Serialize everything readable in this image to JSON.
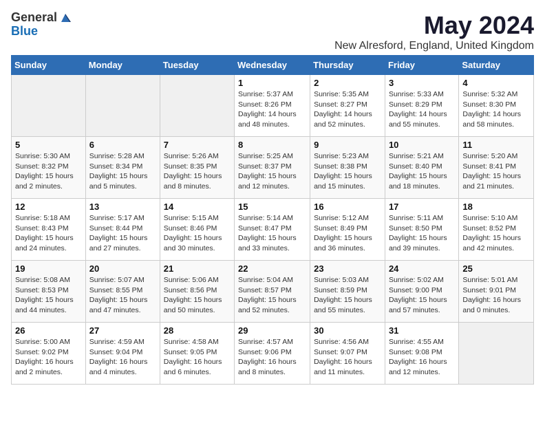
{
  "header": {
    "logo_line1": "General",
    "logo_line2": "Blue",
    "month_title": "May 2024",
    "location": "New Alresford, England, United Kingdom"
  },
  "weekdays": [
    "Sunday",
    "Monday",
    "Tuesday",
    "Wednesday",
    "Thursday",
    "Friday",
    "Saturday"
  ],
  "weeks": [
    [
      {
        "day": "",
        "info": ""
      },
      {
        "day": "",
        "info": ""
      },
      {
        "day": "",
        "info": ""
      },
      {
        "day": "1",
        "info": "Sunrise: 5:37 AM\nSunset: 8:26 PM\nDaylight: 14 hours\nand 48 minutes."
      },
      {
        "day": "2",
        "info": "Sunrise: 5:35 AM\nSunset: 8:27 PM\nDaylight: 14 hours\nand 52 minutes."
      },
      {
        "day": "3",
        "info": "Sunrise: 5:33 AM\nSunset: 8:29 PM\nDaylight: 14 hours\nand 55 minutes."
      },
      {
        "day": "4",
        "info": "Sunrise: 5:32 AM\nSunset: 8:30 PM\nDaylight: 14 hours\nand 58 minutes."
      }
    ],
    [
      {
        "day": "5",
        "info": "Sunrise: 5:30 AM\nSunset: 8:32 PM\nDaylight: 15 hours\nand 2 minutes."
      },
      {
        "day": "6",
        "info": "Sunrise: 5:28 AM\nSunset: 8:34 PM\nDaylight: 15 hours\nand 5 minutes."
      },
      {
        "day": "7",
        "info": "Sunrise: 5:26 AM\nSunset: 8:35 PM\nDaylight: 15 hours\nand 8 minutes."
      },
      {
        "day": "8",
        "info": "Sunrise: 5:25 AM\nSunset: 8:37 PM\nDaylight: 15 hours\nand 12 minutes."
      },
      {
        "day": "9",
        "info": "Sunrise: 5:23 AM\nSunset: 8:38 PM\nDaylight: 15 hours\nand 15 minutes."
      },
      {
        "day": "10",
        "info": "Sunrise: 5:21 AM\nSunset: 8:40 PM\nDaylight: 15 hours\nand 18 minutes."
      },
      {
        "day": "11",
        "info": "Sunrise: 5:20 AM\nSunset: 8:41 PM\nDaylight: 15 hours\nand 21 minutes."
      }
    ],
    [
      {
        "day": "12",
        "info": "Sunrise: 5:18 AM\nSunset: 8:43 PM\nDaylight: 15 hours\nand 24 minutes."
      },
      {
        "day": "13",
        "info": "Sunrise: 5:17 AM\nSunset: 8:44 PM\nDaylight: 15 hours\nand 27 minutes."
      },
      {
        "day": "14",
        "info": "Sunrise: 5:15 AM\nSunset: 8:46 PM\nDaylight: 15 hours\nand 30 minutes."
      },
      {
        "day": "15",
        "info": "Sunrise: 5:14 AM\nSunset: 8:47 PM\nDaylight: 15 hours\nand 33 minutes."
      },
      {
        "day": "16",
        "info": "Sunrise: 5:12 AM\nSunset: 8:49 PM\nDaylight: 15 hours\nand 36 minutes."
      },
      {
        "day": "17",
        "info": "Sunrise: 5:11 AM\nSunset: 8:50 PM\nDaylight: 15 hours\nand 39 minutes."
      },
      {
        "day": "18",
        "info": "Sunrise: 5:10 AM\nSunset: 8:52 PM\nDaylight: 15 hours\nand 42 minutes."
      }
    ],
    [
      {
        "day": "19",
        "info": "Sunrise: 5:08 AM\nSunset: 8:53 PM\nDaylight: 15 hours\nand 44 minutes."
      },
      {
        "day": "20",
        "info": "Sunrise: 5:07 AM\nSunset: 8:55 PM\nDaylight: 15 hours\nand 47 minutes."
      },
      {
        "day": "21",
        "info": "Sunrise: 5:06 AM\nSunset: 8:56 PM\nDaylight: 15 hours\nand 50 minutes."
      },
      {
        "day": "22",
        "info": "Sunrise: 5:04 AM\nSunset: 8:57 PM\nDaylight: 15 hours\nand 52 minutes."
      },
      {
        "day": "23",
        "info": "Sunrise: 5:03 AM\nSunset: 8:59 PM\nDaylight: 15 hours\nand 55 minutes."
      },
      {
        "day": "24",
        "info": "Sunrise: 5:02 AM\nSunset: 9:00 PM\nDaylight: 15 hours\nand 57 minutes."
      },
      {
        "day": "25",
        "info": "Sunrise: 5:01 AM\nSunset: 9:01 PM\nDaylight: 16 hours\nand 0 minutes."
      }
    ],
    [
      {
        "day": "26",
        "info": "Sunrise: 5:00 AM\nSunset: 9:02 PM\nDaylight: 16 hours\nand 2 minutes."
      },
      {
        "day": "27",
        "info": "Sunrise: 4:59 AM\nSunset: 9:04 PM\nDaylight: 16 hours\nand 4 minutes."
      },
      {
        "day": "28",
        "info": "Sunrise: 4:58 AM\nSunset: 9:05 PM\nDaylight: 16 hours\nand 6 minutes."
      },
      {
        "day": "29",
        "info": "Sunrise: 4:57 AM\nSunset: 9:06 PM\nDaylight: 16 hours\nand 8 minutes."
      },
      {
        "day": "30",
        "info": "Sunrise: 4:56 AM\nSunset: 9:07 PM\nDaylight: 16 hours\nand 11 minutes."
      },
      {
        "day": "31",
        "info": "Sunrise: 4:55 AM\nSunset: 9:08 PM\nDaylight: 16 hours\nand 12 minutes."
      },
      {
        "day": "",
        "info": ""
      }
    ]
  ]
}
